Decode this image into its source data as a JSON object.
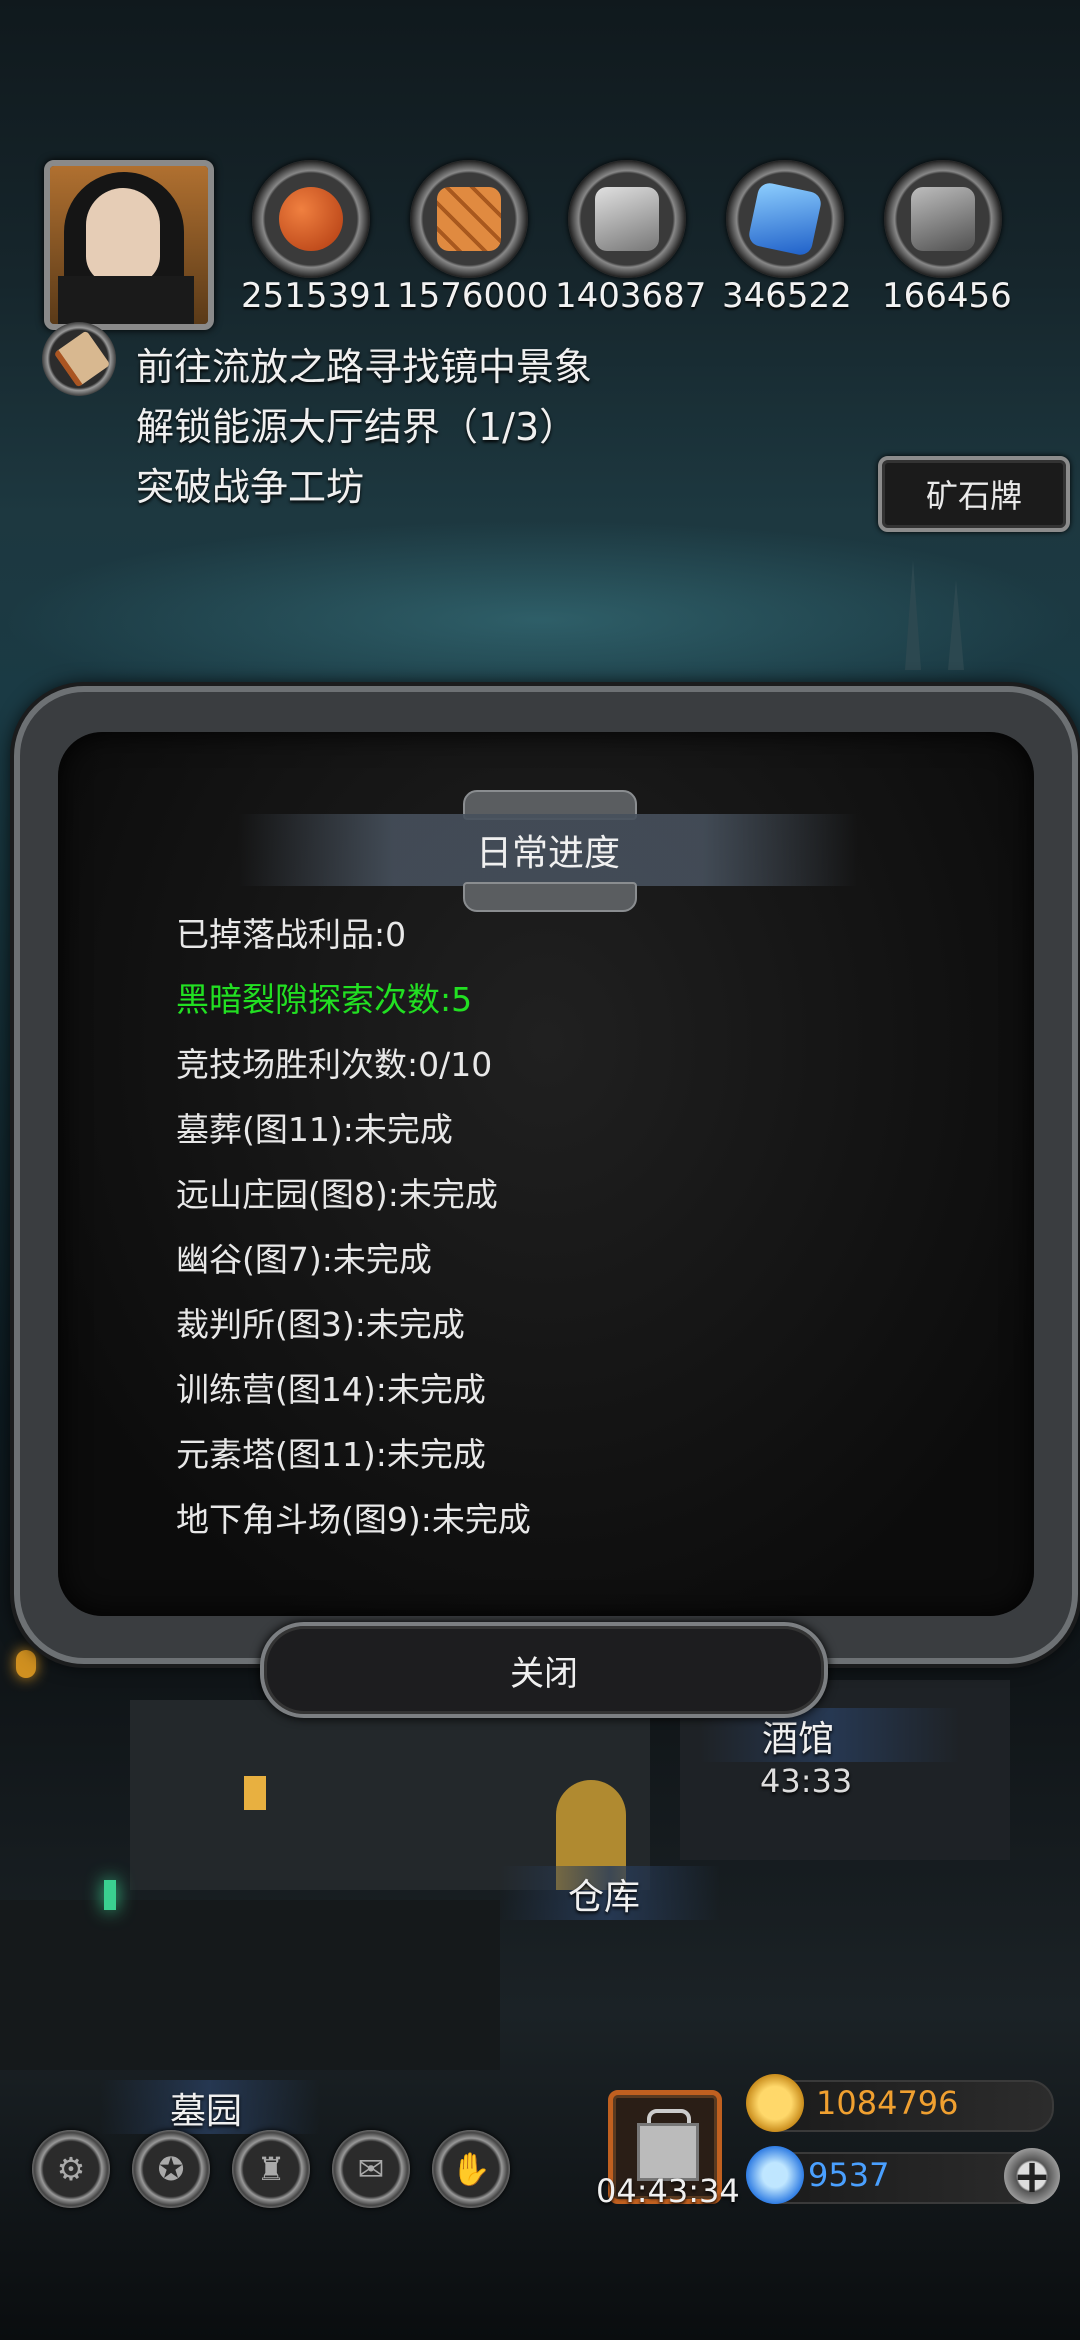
{
  "resources": [
    {
      "icon": "meat-icon",
      "value": "2515391",
      "color": "#d0581e"
    },
    {
      "icon": "wood-icon",
      "value": "1576000",
      "color": "#d87a34"
    },
    {
      "icon": "iron-icon",
      "value": "1403687",
      "color": "#b0b0b0"
    },
    {
      "icon": "crystal-icon",
      "value": "346522",
      "color": "#3a86e8"
    },
    {
      "icon": "stone-icon",
      "value": "166456",
      "color": "#8c8c8c"
    }
  ],
  "quests": [
    "前往流放之路寻找镜中景象",
    "解锁能源大厅结界（1/3）",
    "突破战争工坊"
  ],
  "ore_button": "矿石牌",
  "dialog": {
    "title": "日常进度",
    "rows": [
      "已掉落战利品:0",
      "黑暗裂隙探索次数:5",
      "竞技场胜利次数:0/10",
      "墓葬(图11):未完成",
      "远山庄园(图8):未完成",
      "幽谷(图7):未完成",
      "裁判所(图3):未完成",
      "训练营(图14):未完成",
      "元素塔(图11):未完成",
      "地下角斗场(图9):未完成"
    ],
    "close": "关闭"
  },
  "town": {
    "tavern": "酒馆",
    "tavern_timer": "43:33",
    "warehouse": "仓库",
    "graveyard": "墓园"
  },
  "bottom": {
    "gift_timer": "04:43:34",
    "gold": "1084796",
    "gems": "9537",
    "tools": [
      "settings-icon",
      "achievement-icon",
      "castle-icon",
      "mail-icon",
      "handshake-icon"
    ]
  },
  "colors": {
    "green_text": "#22e022",
    "gold_text": "#f0a030",
    "gem_text": "#4aa0ff"
  }
}
